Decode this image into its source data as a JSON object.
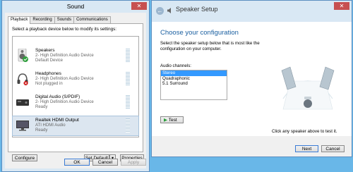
{
  "sound_dialog": {
    "title": "Sound",
    "close": "✕",
    "tabs": [
      "Playback",
      "Recording",
      "Sounds",
      "Communications"
    ],
    "instruction": "Select a playback device below to modify its settings:",
    "devices": [
      {
        "name": "Speakers",
        "line1": "2- High Definition Audio Device",
        "line2": "Default Device",
        "icon": "speaker-icon"
      },
      {
        "name": "Headphones",
        "line1": "2- High Definition Audio Device",
        "line2": "Not plugged in",
        "icon": "headphones-icon"
      },
      {
        "name": "Digital Audio (S/PDIF)",
        "line1": "2- High Definition Audio Device",
        "line2": "Ready",
        "icon": "digital-audio-icon"
      },
      {
        "name": "Realtek HDMI Output",
        "line1": "ATI HDMI Audio",
        "line2": "Ready",
        "icon": "monitor-icon"
      }
    ],
    "buttons": {
      "configure": "Configure",
      "set_default": "Set Default",
      "dropdown": "▾",
      "properties": "Properties",
      "ok": "OK",
      "cancel": "Cancel",
      "apply": "Apply"
    }
  },
  "speaker_setup": {
    "title": "Speaker Setup",
    "close": "✕",
    "back": "←",
    "heading": "Choose your configuration",
    "description": "Select the speaker setup below that is most like the configuration on your computer.",
    "channels_label": "Audio channels:",
    "channels": [
      "Stereo",
      "Quadraphonic",
      "5.1 Surround"
    ],
    "selected_channel": "Stereo",
    "test_button": "Test",
    "hint": "Click any speaker above to test it.",
    "next_button": "Next",
    "cancel_button": "Cancel"
  }
}
